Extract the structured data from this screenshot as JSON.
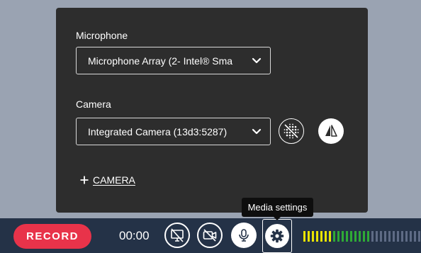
{
  "panel": {
    "microphone_label": "Microphone",
    "microphone_value": "Microphone Array (2- Intel® Sma",
    "camera_label": "Camera",
    "camera_value": "Integrated Camera (13d3:5287)",
    "add_camera_label": "CAMERA",
    "icons": {
      "blur": "background-blur-icon",
      "mirror": "mirror-flip-icon",
      "plus": "plus-icon",
      "chevron": "chevron-down-icon"
    }
  },
  "tooltip": {
    "text": "Media settings"
  },
  "toolbar": {
    "record_label": "RECORD",
    "timer": "00:00",
    "icons": {
      "screen": "screen-share-off-icon",
      "camera": "camera-off-icon",
      "mic": "microphone-icon",
      "settings": "gear-icon"
    },
    "audio_meter": {
      "segment_count": 30,
      "active_segments": 16,
      "colors": {
        "yellow": "#e9e400",
        "green": "#2faa36",
        "inactive": "#5e6b85"
      }
    }
  },
  "colors": {
    "page_background": "#9aa3b2",
    "panel_background": "#2d2d2d",
    "toolbar_background": "#243247",
    "record_red": "#e8334a",
    "tooltip_background": "#0e0e0e"
  }
}
